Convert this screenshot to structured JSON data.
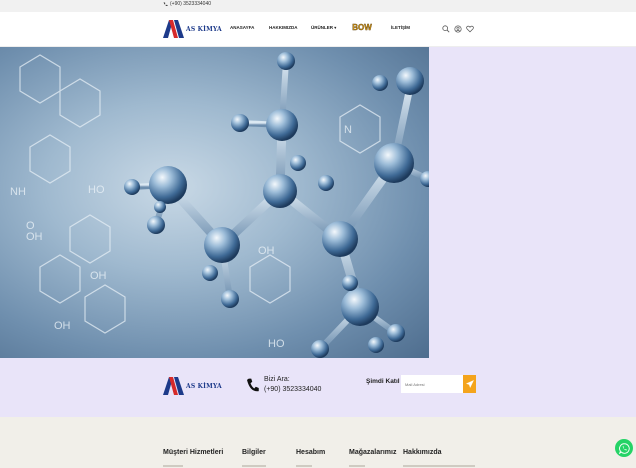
{
  "topbar": {
    "phone": "(+90) 3523334040"
  },
  "brand": {
    "name": "AS KİMYA"
  },
  "nav": {
    "items": [
      {
        "label": "ANASAYFA"
      },
      {
        "label": "HAKKIMIZDA"
      },
      {
        "label": "ÜRÜNLER"
      },
      {
        "label": "İLETİŞİM"
      }
    ],
    "badge_text": "BOW"
  },
  "header_icons": [
    "search-icon",
    "user-icon",
    "heart-icon"
  ],
  "contact": {
    "call_label": "Bizi Ara:",
    "call_number": "(+90) 3523334040"
  },
  "newsletter": {
    "label": "Şimdi Katıl :",
    "placeholder": "Mail Adresi"
  },
  "footer": {
    "columns": [
      {
        "title": "Müşteri Hizmetleri"
      },
      {
        "title": "Bilgiler"
      },
      {
        "title": "Hesabım"
      },
      {
        "title": "Mağazalarımız"
      },
      {
        "title": "Hakkımızda"
      }
    ]
  },
  "colors": {
    "accent": "#f4a41c",
    "band": "#e9e4f9",
    "footer": "#f1efe9",
    "whatsapp": "#25d366",
    "logo_blue": "#1d3a8a",
    "logo_red": "#d62a2a"
  }
}
